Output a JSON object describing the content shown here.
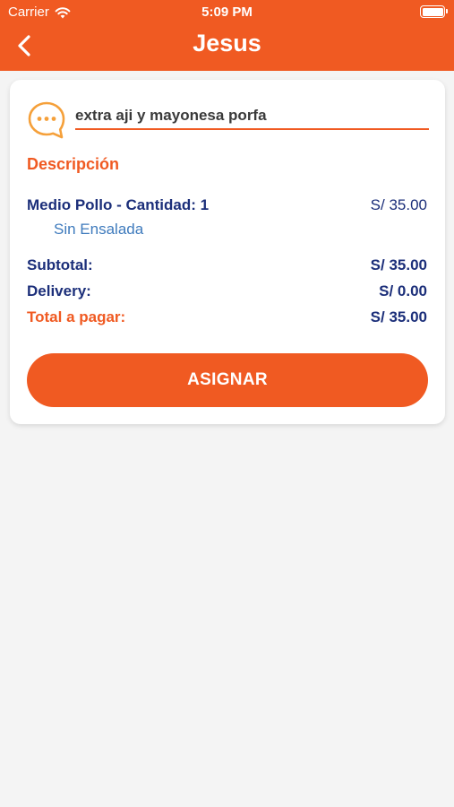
{
  "status_bar": {
    "carrier": "Carrier",
    "time": "5:09 PM"
  },
  "header": {
    "title": "Jesus",
    "back_icon": "chevron-left-icon",
    "color": "#f05a22"
  },
  "note": {
    "icon": "chat-bubble-icon",
    "value": "extra aji y mayonesa porfa"
  },
  "description": {
    "title": "Descripción",
    "items": [
      {
        "name": "Medio Pollo - Cantidad: 1",
        "price": "S/ 35.00",
        "option": "Sin Ensalada"
      }
    ]
  },
  "summary": {
    "subtotal_label": "Subtotal:",
    "subtotal_value": "S/ 35.00",
    "delivery_label": "Delivery:",
    "delivery_value": "S/ 0.00",
    "total_label": "Total a pagar:",
    "total_value": "S/ 35.00"
  },
  "actions": {
    "assign_label": "ASIGNAR"
  },
  "colors": {
    "accent": "#f05a22",
    "navy": "#1c2f7a",
    "link_blue": "#3f7bbd"
  }
}
